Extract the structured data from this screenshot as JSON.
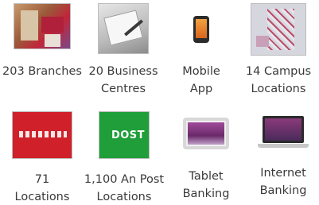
{
  "channels": [
    {
      "label_line1": "203 Branches",
      "label_line2": "",
      "icon": "branch-interior-photo"
    },
    {
      "label_line1": "20 Business",
      "label_line2": "Centres",
      "icon": "business-document-signing-photo"
    },
    {
      "label_line1": "Mobile",
      "label_line2": "App",
      "icon": "smartphone-icon"
    },
    {
      "label_line1": "14 Campus",
      "label_line2": "Locations",
      "icon": "campus-map-photo"
    },
    {
      "label_line1": "71",
      "label_line2": "Locations",
      "icon": "red-store-sign-photo"
    },
    {
      "label_line1": "1,100 An Post",
      "label_line2": "Locations",
      "icon": "an-post-logo"
    },
    {
      "label_line1": "Tablet",
      "label_line2": "Banking",
      "icon": "tablet-icon"
    },
    {
      "label_line1": "Internet",
      "label_line2": "Banking",
      "icon": "laptop-icon"
    }
  ],
  "logo_text": {
    "an_post": "DOST"
  },
  "colors": {
    "label_text": "#3a3a3a",
    "red_sign": "#d0202a",
    "an_post_green": "#1f9e3a"
  }
}
